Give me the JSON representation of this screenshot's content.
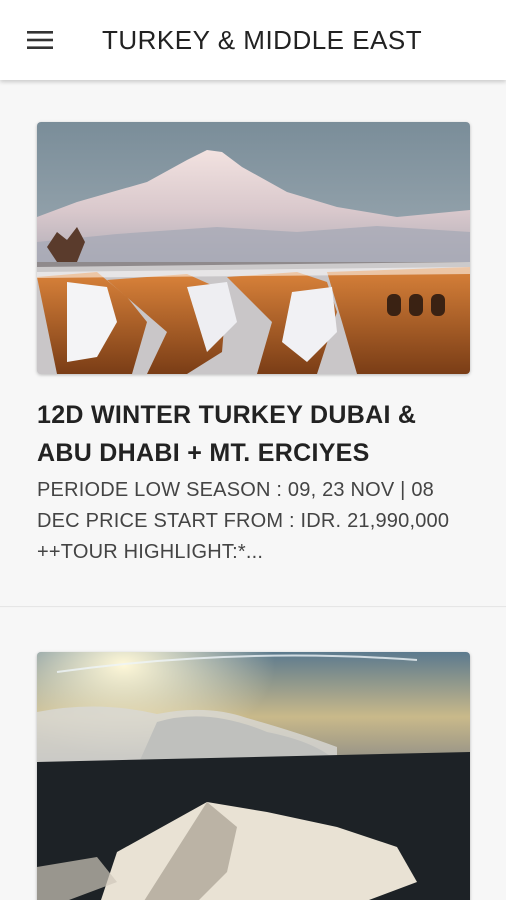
{
  "appbar": {
    "menu_icon": "hamburger-menu-icon",
    "title": "TURKEY & MIDDLE EAST"
  },
  "posts": [
    {
      "title": "12D WINTER TURKEY DUBAI & ABU DHABI + MT. ERCIYES",
      "excerpt": "PERIODE LOW SEASON : 09, 23 NOV | 08 DEC PRICE START FROM : IDR. 21,990,000 ++TOUR HIGHLIGHT:*..."
    },
    {
      "title": "",
      "excerpt": ""
    }
  ],
  "colors": {
    "appbar_bg": "#ffffff",
    "page_bg": "#f5f5f5",
    "text": "#222222"
  }
}
